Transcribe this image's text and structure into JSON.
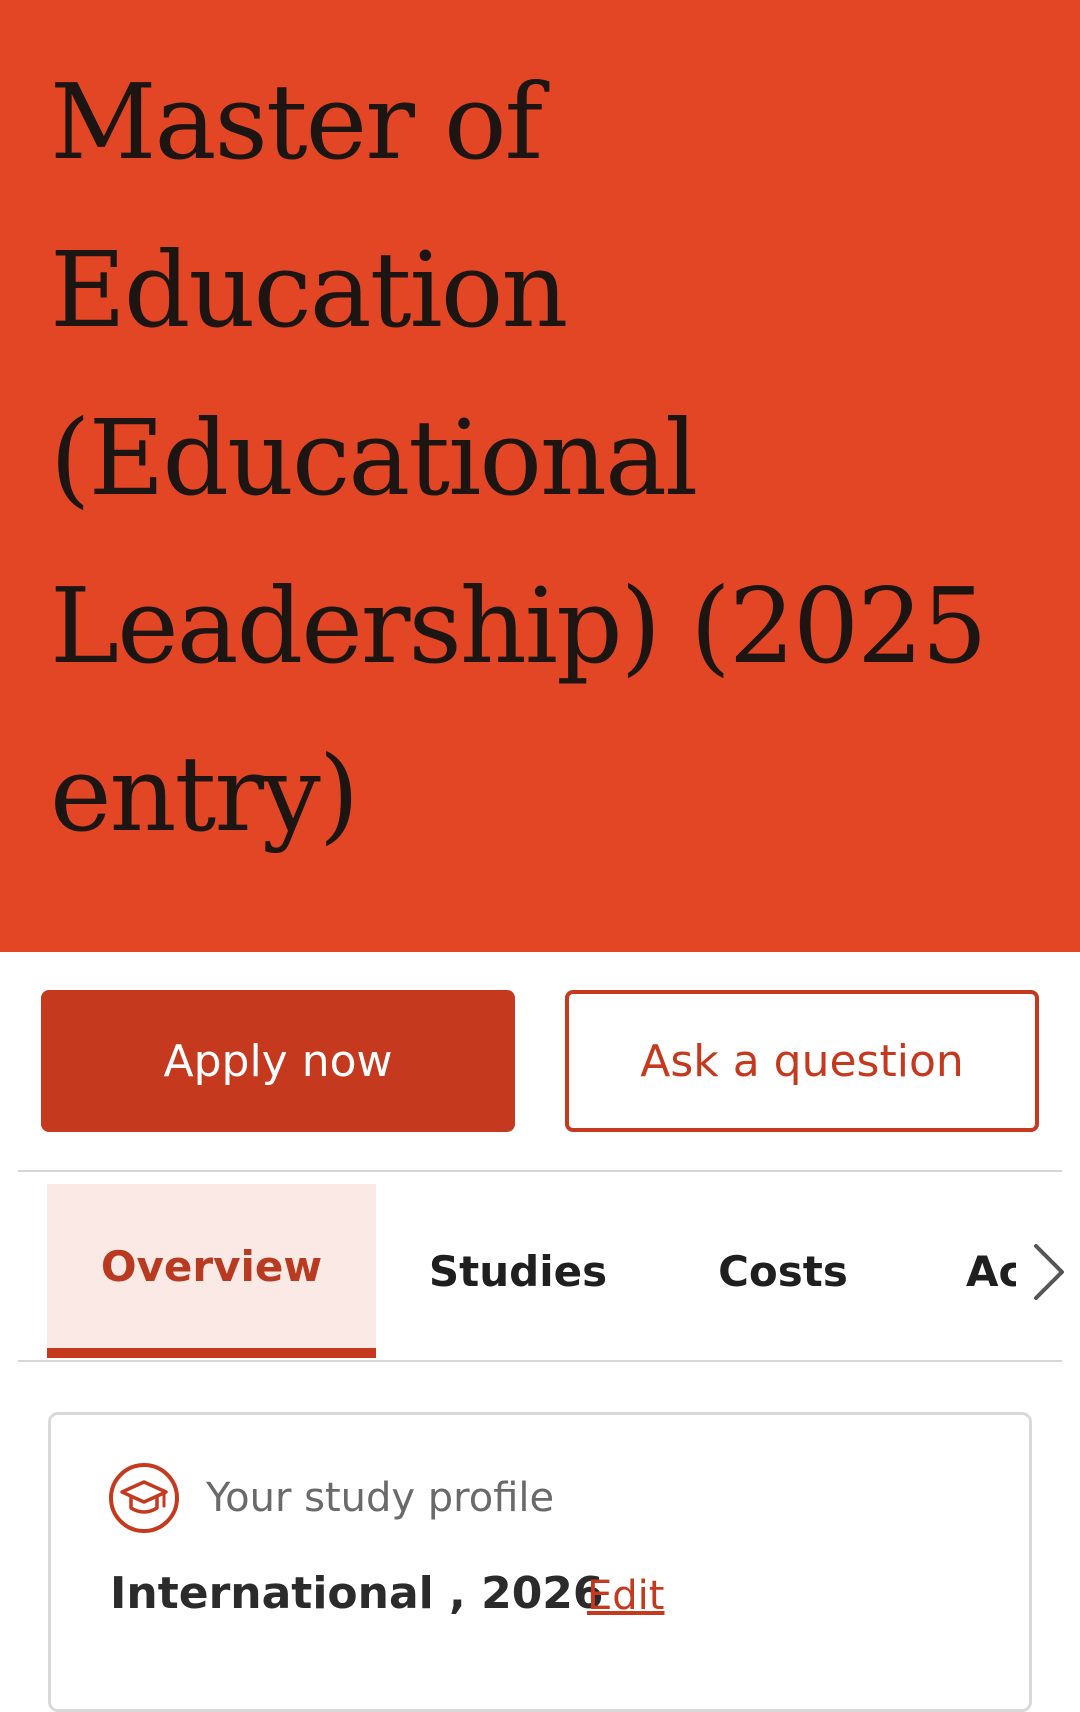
{
  "hero": {
    "title": "Master of Education (Educational Leadership) (2025 entry)",
    "background_color": "#e34625"
  },
  "actions": {
    "apply_label": "Apply now",
    "ask_label": "Ask a question",
    "accent_color": "#c53a1f"
  },
  "tabs": {
    "items": [
      {
        "label": "Overview",
        "active": true
      },
      {
        "label": "Studies",
        "active": false
      },
      {
        "label": "Costs",
        "active": false
      },
      {
        "label": "Ac",
        "active": false
      }
    ],
    "scroll_icon": "chevron-right-icon"
  },
  "study_profile": {
    "icon": "graduation-cap-icon",
    "label": "Your study profile",
    "value": "International , 2026",
    "edit_label": "Edit"
  }
}
